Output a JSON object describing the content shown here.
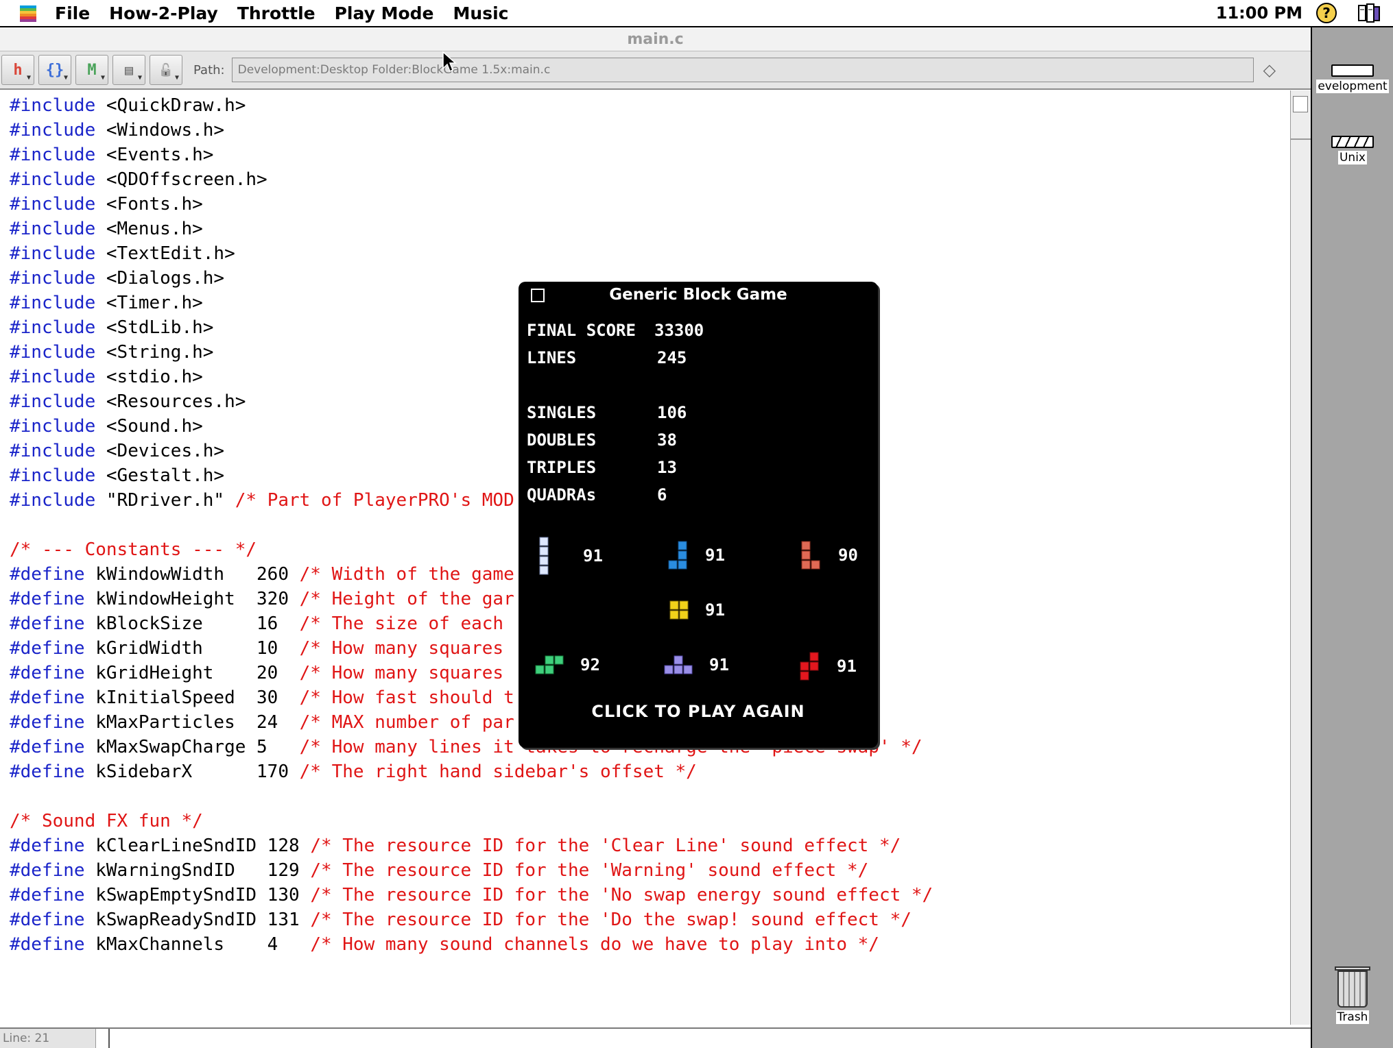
{
  "menubar": {
    "items": [
      "File",
      "How-2-Play",
      "Throttle",
      "Play Mode",
      "Music"
    ],
    "clock": "11:00 PM",
    "help_glyph": "?"
  },
  "editor": {
    "title": "main.c",
    "path_label": "Path:",
    "path_value": "Development:Desktop Folder:BlockGame 1.5x:main.c",
    "line_indicator": "Line: 21",
    "toolbar_buttons": [
      {
        "name": "function-popup-icon",
        "glyph": "h"
      },
      {
        "name": "header-popup-icon",
        "glyph": "{}"
      },
      {
        "name": "marker-popup-icon",
        "glyph": "M"
      },
      {
        "name": "document-popup-icon",
        "glyph": "▤"
      },
      {
        "name": "lock-icon",
        "glyph": "🔓"
      }
    ],
    "code": [
      [
        {
          "t": "#include",
          "c": "kw"
        },
        {
          "t": " <QuickDraw.h>"
        }
      ],
      [
        {
          "t": "#include",
          "c": "kw"
        },
        {
          "t": " <Windows.h>"
        }
      ],
      [
        {
          "t": "#include",
          "c": "kw"
        },
        {
          "t": " <Events.h>"
        }
      ],
      [
        {
          "t": "#include",
          "c": "kw"
        },
        {
          "t": " <QDOffscreen.h>"
        }
      ],
      [
        {
          "t": "#include",
          "c": "kw"
        },
        {
          "t": " <Fonts.h>"
        }
      ],
      [
        {
          "t": "#include",
          "c": "kw"
        },
        {
          "t": " <Menus.h>"
        }
      ],
      [
        {
          "t": "#include",
          "c": "kw"
        },
        {
          "t": " <TextEdit.h>"
        }
      ],
      [
        {
          "t": "#include",
          "c": "kw"
        },
        {
          "t": " <Dialogs.h>"
        }
      ],
      [
        {
          "t": "#include",
          "c": "kw"
        },
        {
          "t": " <Timer.h>"
        }
      ],
      [
        {
          "t": "#include",
          "c": "kw"
        },
        {
          "t": " <StdLib.h>"
        }
      ],
      [
        {
          "t": "#include",
          "c": "kw"
        },
        {
          "t": " <String.h>"
        }
      ],
      [
        {
          "t": "#include",
          "c": "kw"
        },
        {
          "t": " <stdio.h>"
        }
      ],
      [
        {
          "t": "#include",
          "c": "kw"
        },
        {
          "t": " <Resources.h>"
        }
      ],
      [
        {
          "t": "#include",
          "c": "kw"
        },
        {
          "t": " <Sound.h>"
        }
      ],
      [
        {
          "t": "#include",
          "c": "kw"
        },
        {
          "t": " <Devices.h>"
        }
      ],
      [
        {
          "t": "#include",
          "c": "kw"
        },
        {
          "t": " <Gestalt.h>"
        }
      ],
      [
        {
          "t": "#include",
          "c": "kw"
        },
        {
          "t": " \"RDriver.h\" "
        },
        {
          "t": "/* Part of PlayerPRO's MOD",
          "c": "cm"
        }
      ],
      [],
      [
        {
          "t": "/* --- Constants --- */",
          "c": "cm"
        }
      ],
      [
        {
          "t": "#define",
          "c": "kw"
        },
        {
          "t": " kWindowWidth   260 "
        },
        {
          "t": "/* Width of the game",
          "c": "cm"
        }
      ],
      [
        {
          "t": "#define",
          "c": "kw"
        },
        {
          "t": " kWindowHeight  320 "
        },
        {
          "t": "/* Height of the gar",
          "c": "cm"
        }
      ],
      [
        {
          "t": "#define",
          "c": "kw"
        },
        {
          "t": " kBlockSize     16  "
        },
        {
          "t": "/* The size of each",
          "c": "cm"
        }
      ],
      [
        {
          "t": "#define",
          "c": "kw"
        },
        {
          "t": " kGridWidth     10  "
        },
        {
          "t": "/* How many squares",
          "c": "cm"
        }
      ],
      [
        {
          "t": "#define",
          "c": "kw"
        },
        {
          "t": " kGridHeight    20  "
        },
        {
          "t": "/* How many squares",
          "c": "cm"
        }
      ],
      [
        {
          "t": "#define",
          "c": "kw"
        },
        {
          "t": " kInitialSpeed  30  "
        },
        {
          "t": "/* How fast should t",
          "c": "cm"
        }
      ],
      [
        {
          "t": "#define",
          "c": "kw"
        },
        {
          "t": " kMaxParticles  24  "
        },
        {
          "t": "/* MAX number of par",
          "c": "cm"
        }
      ],
      [
        {
          "t": "#define",
          "c": "kw"
        },
        {
          "t": " kMaxSwapCharge 5   "
        },
        {
          "t": "/* How many lines it takes to recharge the 'piece swap' */",
          "c": "cm"
        }
      ],
      [
        {
          "t": "#define",
          "c": "kw"
        },
        {
          "t": " kSidebarX      170 "
        },
        {
          "t": "/* The right hand sidebar's offset */",
          "c": "cm"
        }
      ],
      [],
      [
        {
          "t": "/* Sound FX fun */",
          "c": "cm"
        }
      ],
      [
        {
          "t": "#define",
          "c": "kw"
        },
        {
          "t": " kClearLineSndID 128 "
        },
        {
          "t": "/* The resource ID for the 'Clear Line' sound effect */",
          "c": "cm"
        }
      ],
      [
        {
          "t": "#define",
          "c": "kw"
        },
        {
          "t": " kWarningSndID   129 "
        },
        {
          "t": "/* The resource ID for the 'Warning' sound effect */",
          "c": "cm"
        }
      ],
      [
        {
          "t": "#define",
          "c": "kw"
        },
        {
          "t": " kSwapEmptySndID 130 "
        },
        {
          "t": "/* The resource ID for the 'No swap energy sound effect */",
          "c": "cm"
        }
      ],
      [
        {
          "t": "#define",
          "c": "kw"
        },
        {
          "t": " kSwapReadySndID 131 "
        },
        {
          "t": "/* The resource ID for the 'Do the swap! sound effect */",
          "c": "cm"
        }
      ],
      [
        {
          "t": "#define",
          "c": "kw"
        },
        {
          "t": " kMaxChannels    4   "
        },
        {
          "t": "/* How many sound channels do we have to play into */",
          "c": "cm"
        }
      ]
    ]
  },
  "desktop": {
    "icons": [
      {
        "label": "evelopment"
      },
      {
        "label": "Unix"
      }
    ],
    "trash_label": "Trash"
  },
  "game": {
    "title": "Generic Block Game",
    "stats": [
      {
        "label": "FINAL SCORE",
        "value": "33300"
      },
      {
        "label": "LINES",
        "value": "245"
      },
      {
        "label": "SINGLES",
        "value": "106"
      },
      {
        "label": "DOUBLES",
        "value": "38"
      },
      {
        "label": "TRIPLES",
        "value": "13"
      },
      {
        "label": "QUADRAs",
        "value": "6"
      }
    ],
    "pieces": [
      {
        "shape": "I",
        "color": "#dfe8ff",
        "count": "91"
      },
      {
        "shape": "J",
        "color": "#2a8de0",
        "count": "91"
      },
      {
        "shape": "L",
        "color": "#e06a55",
        "count": "90"
      },
      {
        "shape": "O",
        "color": "#f1d21a",
        "count": "91"
      },
      {
        "shape": "S",
        "color": "#3fcf7c",
        "count": "92"
      },
      {
        "shape": "T",
        "color": "#9a8fe8",
        "count": "91"
      },
      {
        "shape": "Z",
        "color": "#e3171e",
        "count": "91"
      }
    ],
    "play_again": "CLICK TO PLAY AGAIN"
  }
}
